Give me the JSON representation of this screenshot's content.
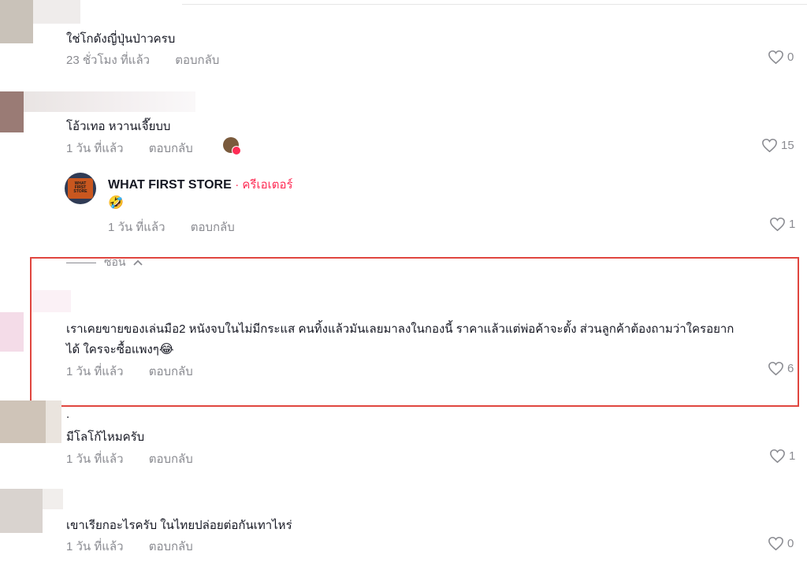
{
  "comments": [
    {
      "text": "ใช่โกดังญี่ปุ่นป่าวครบ",
      "time": "23 ชั่วโมง ที่แล้ว",
      "reply": "ตอบกลับ",
      "likes": "0"
    },
    {
      "text": "โอ้วเทอ หวานเจี๊ยบบ",
      "time": "1 วัน ที่แล้ว",
      "reply": "ตอบกลับ",
      "likes": "15"
    },
    {
      "text": "เราเคยขายของเล่นมือ2 หนังจบในไม่มีกระแส คนทิ้งแล้วมันเลยมาลงในกองนี้ ราคาแล้วแต่พ่อค้าจะตั้ง ส่วนลูกค้าต้องถามว่าใครอยาก",
      "text2": "ได้ ใครจะซื้อแพงๆ",
      "emoji": "😂",
      "time": "1 วัน ที่แล้ว",
      "reply": "ตอบกลับ",
      "likes": "6"
    },
    {
      "text_top": ".",
      "text": "มีโลโก้ไหมครับ",
      "time": "1 วัน ที่แล้ว",
      "reply": "ตอบกลับ",
      "likes": "1"
    },
    {
      "text": "เขาเรียกอะไรครับ ในไทยปล่อยต่อกันเทาไหร่",
      "time": "1 วัน ที่แล้ว",
      "reply": "ตอบกลับ",
      "likes": "0"
    }
  ],
  "creator_reply": {
    "name": "WHAT FIRST STORE",
    "tag": "· ครีเอเตอร์",
    "emoji": "🤣",
    "time": "1 วัน ที่แล้ว",
    "reply": "ตอบกลับ",
    "likes": "1"
  },
  "hide_label": "ซ่อน",
  "colors": {
    "accent": "#fe2c55",
    "highlight_box": "#e0463f",
    "muted": "#8a8b91"
  }
}
